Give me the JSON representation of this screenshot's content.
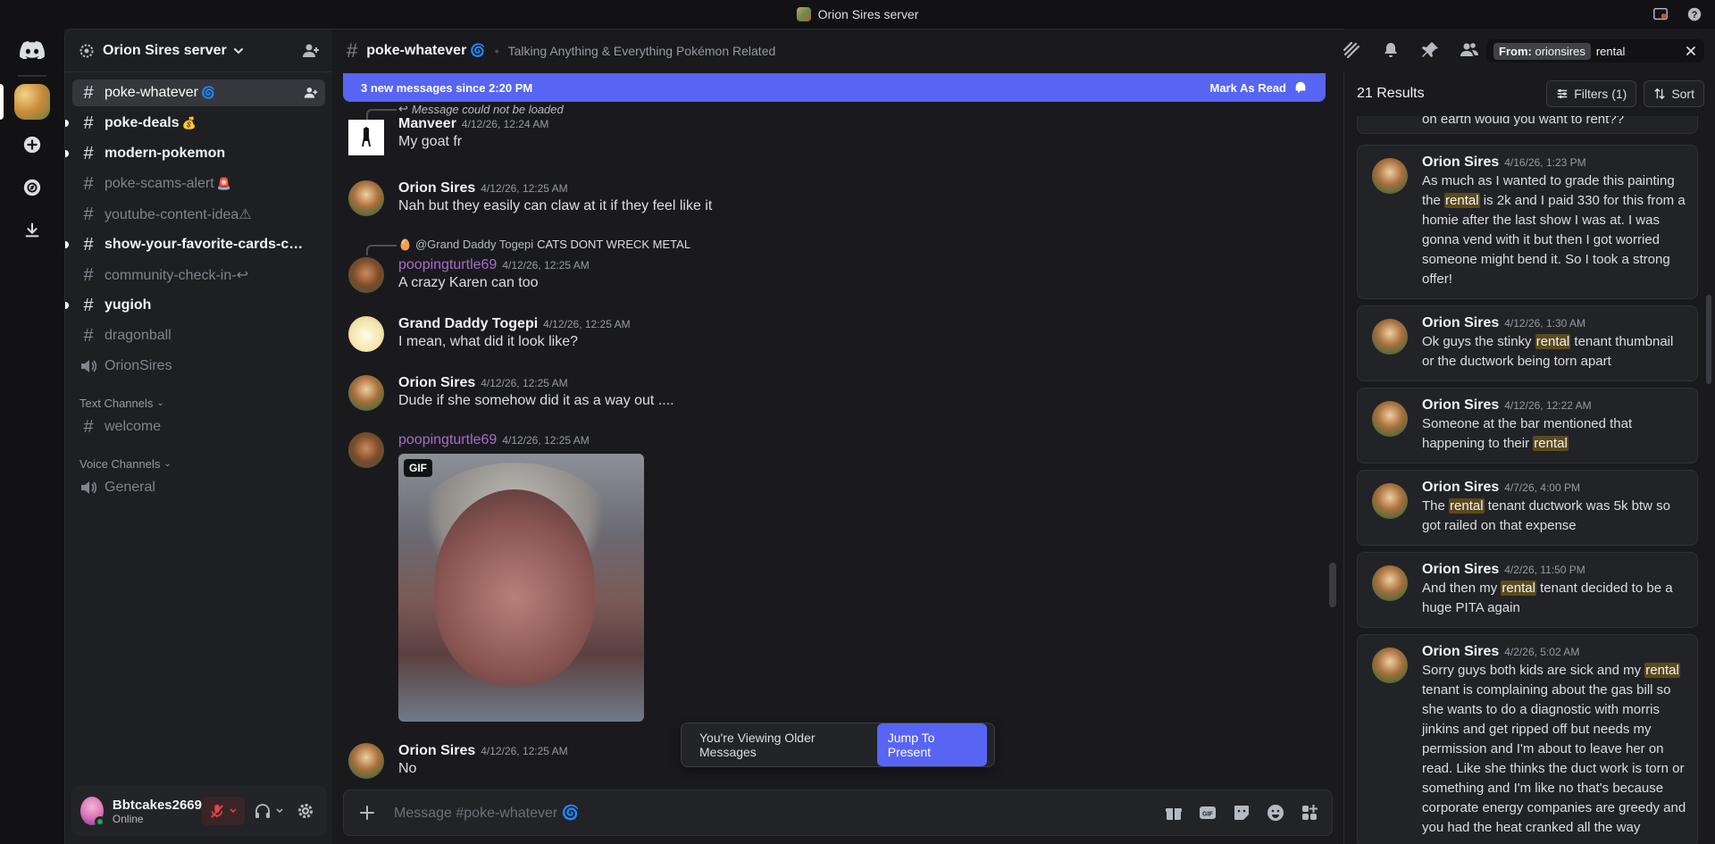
{
  "window": {
    "title": "Orion Sires server"
  },
  "server": {
    "name": "Orion Sires server"
  },
  "channels": [
    {
      "name": "poke-whatever",
      "emoji": "🌀",
      "state": "active",
      "type": "text"
    },
    {
      "name": "poke-deals",
      "emoji": "💰",
      "state": "unread",
      "type": "text"
    },
    {
      "name": "modern-pokemon",
      "emoji": "",
      "state": "unread",
      "type": "text"
    },
    {
      "name": "poke-scams-alert",
      "emoji": "🚨",
      "state": "muted",
      "type": "text"
    },
    {
      "name": "youtube-content-idea⚠",
      "emoji": "",
      "state": "muted",
      "type": "text"
    },
    {
      "name": "show-your-favorite-cards-colle...",
      "emoji": "",
      "state": "unread",
      "type": "text"
    },
    {
      "name": "community-check-in-↩",
      "emoji": "",
      "state": "muted",
      "type": "text"
    },
    {
      "name": "yugioh",
      "emoji": "",
      "state": "unread",
      "type": "text"
    },
    {
      "name": "dragonball",
      "emoji": "",
      "state": "muted",
      "type": "text"
    },
    {
      "name": "OrionSires",
      "emoji": "",
      "state": "muted",
      "type": "voice"
    }
  ],
  "categories": {
    "text": {
      "label": "Text Channels",
      "channel": "welcome"
    },
    "voice": {
      "label": "Voice Channels",
      "channel": "General"
    }
  },
  "user": {
    "name": "Bbtcakes2669",
    "status": "Online"
  },
  "chat": {
    "channel": "poke-whatever",
    "topic": "Talking Anything & Everything Pokémon Related",
    "new_messages": "3 new messages since 2:20 PM",
    "mark_as_read": "Mark As Read",
    "placeholder": "Message #poke-whatever 🌀",
    "older_text": "You're Viewing Older Messages",
    "jump_label": "Jump To Present"
  },
  "messages": [
    {
      "reply": "Message could not be loaded",
      "author": "Manveer",
      "time": "4/12/26, 12:24 AM",
      "text": "My goat fr"
    },
    {
      "author": "Orion Sires",
      "time": "4/12/26, 12:25 AM",
      "text": "Nah but they easily can claw at it if they feel like it"
    },
    {
      "reply_author": "@Grand Daddy Togepi",
      "reply": "CATS DONT WRECK METAL",
      "author": "poopingturtle69",
      "time": "4/12/26, 12:25 AM",
      "text": "A crazy Karen can too"
    },
    {
      "author": "Grand Daddy Togepi",
      "time": "4/12/26, 12:25 AM",
      "text": "I mean, what did it look like?"
    },
    {
      "author": "Orion Sires",
      "time": "4/12/26, 12:25 AM",
      "text": "Dude if she somehow did it as a way out ...."
    },
    {
      "author": "poopingturtle69",
      "time": "4/12/26, 12:25 AM",
      "gif_label": "GIF"
    },
    {
      "author": "Orion Sires",
      "time": "4/12/26, 12:25 AM",
      "text": "No"
    }
  ],
  "search": {
    "filter_chip_prefix": "From:",
    "filter_chip_value": "orionsires",
    "query": "rental",
    "result_count": "21 Results",
    "filters_label": "Filters (1)",
    "sort_label": "Sort",
    "partial_text": "on earth would you want to rent??",
    "results": [
      {
        "author": "Orion Sires",
        "time": "4/16/26, 1:23 PM",
        "before": "As much as I wanted to grade this painting the ",
        "hl": "rental",
        "after": " is 2k and I paid 330 for this from a homie after the last show I was at. I was gonna vend with it but then I got worried someone might bend it. So I took a strong offer!"
      },
      {
        "author": "Orion Sires",
        "time": "4/12/26, 1:30 AM",
        "before": "Ok guys the stinky ",
        "hl": "rental",
        "after": " tenant thumbnail or the ductwork being torn apart"
      },
      {
        "author": "Orion Sires",
        "time": "4/12/26, 12:22 AM",
        "before": "Someone at the bar mentioned that happening to their ",
        "hl": "rental",
        "after": ""
      },
      {
        "author": "Orion Sires",
        "time": "4/7/26, 4:00 PM",
        "before": "The ",
        "hl": "rental",
        "after": " tenant ductwork was 5k btw so got railed on that expense"
      },
      {
        "author": "Orion Sires",
        "time": "4/2/26, 11:50 PM",
        "before": "And then my ",
        "hl": "rental",
        "after": " tenant decided to be a huge PITA again"
      },
      {
        "author": "Orion Sires",
        "time": "4/2/26, 5:02 AM",
        "before": "Sorry guys both kids are sick and my ",
        "hl": "rental",
        "after": " tenant is complaining about the gas bill so she wants to do a diagnostic with morris jinkins and get ripped off but needs my permission and I'm about to leave her on read. Like she thinks the duct work is torn or something and I'm like no that's because corporate energy companies are greedy and you had the heat cranked all the way"
      }
    ]
  },
  "colors": {
    "accent": "#5865f2",
    "background": "#1a1a1e",
    "sidebar": "#1e1f22",
    "highlight": "#5c4a1c",
    "online": "#23a55a",
    "muted_red": "#f23f43"
  }
}
